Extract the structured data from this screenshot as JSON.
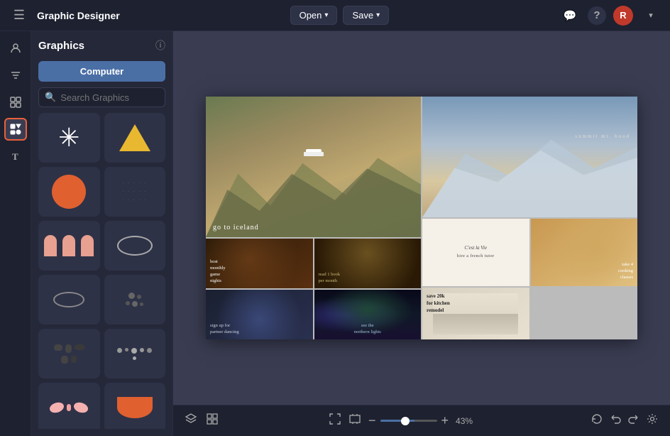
{
  "app": {
    "title": "Graphic Designer",
    "hamburger": "☰"
  },
  "topbar": {
    "open_label": "Open",
    "save_label": "Save",
    "chevron": "▾"
  },
  "topbar_right": {
    "comment_icon": "💬",
    "help_icon": "?",
    "avatar_label": "R",
    "chevron": "▾"
  },
  "panel": {
    "title": "Graphics",
    "info_icon": "ⓘ",
    "computer_btn": "Computer",
    "search_placeholder": "Search Graphics"
  },
  "canvas": {
    "moodboard": {
      "top_left_text": "go to iceland",
      "summit_text": "summit mt. hood",
      "game_text": "host\nmonthly\ngame\nnights",
      "book_text": "read 1 book\nper month",
      "dance_text": "sign up for\npartner dancing",
      "lights_text": "see the\nnorthern lights",
      "tutor_text": "C'est la Vie\nhire a french tutor",
      "kitchen_text": "save 20k\nfor kitchen\nremodel",
      "pastry_text": "take 4\ncooking\nclasses"
    }
  },
  "bottom_toolbar": {
    "zoom_value": "43%",
    "zoom_minus": "−",
    "zoom_plus": "+"
  }
}
